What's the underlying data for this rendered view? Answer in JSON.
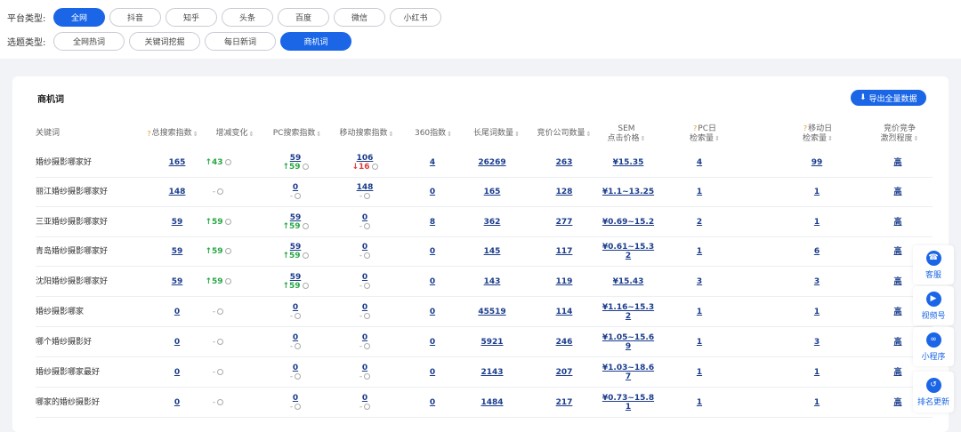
{
  "filters": {
    "platform_label": "平台类型:",
    "platforms": [
      "全网",
      "抖音",
      "知乎",
      "头条",
      "百度",
      "微信",
      "小红书"
    ],
    "platform_active": 0,
    "topic_label": "选题类型:",
    "topics": [
      "全网热词",
      "关键词挖掘",
      "每日新词",
      "商机词"
    ],
    "topic_active": 3
  },
  "card": {
    "title": "商机词",
    "export_label": "导出全量数据"
  },
  "headers": {
    "keyword": "关键词",
    "total": "总搜索指数",
    "change": "增减变化",
    "pc": "PC搜索指数",
    "mobile": "移动搜索指数",
    "s360": "360指数",
    "longtail": "长尾词数量",
    "bidco": "竞价公司数量",
    "sem_line1": "SEM",
    "sem_line2": "点击价格",
    "pcday_line1": "PC日",
    "pcday_line2": "检索量",
    "mday_line1": "移动日",
    "mday_line2": "检索量",
    "comp_line1": "竞价竞争",
    "comp_line2": "激烈程度"
  },
  "rows": [
    {
      "keyword": "婚纱摄影哪家好",
      "total": "165",
      "change": "43",
      "change_dir": "up",
      "pc": "59",
      "pc_sub": "59",
      "pc_sub_dir": "up",
      "mobile": "106",
      "mobile_sub": "16",
      "mobile_sub_dir": "down",
      "s360": "4",
      "longtail": "26269",
      "bidco": "263",
      "sem1": "¥15.35",
      "sem2": "",
      "pcday": "4",
      "mday": "99",
      "comp": "高"
    },
    {
      "keyword": "丽江婚纱摄影哪家好",
      "total": "148",
      "change": "-",
      "change_dir": "none",
      "pc": "0",
      "pc_sub": "-",
      "pc_sub_dir": "none",
      "mobile": "148",
      "mobile_sub": "-",
      "mobile_sub_dir": "none",
      "s360": "0",
      "longtail": "165",
      "bidco": "128",
      "sem1": "¥1.1~13.25",
      "sem2": "",
      "pcday": "1",
      "mday": "1",
      "comp": "高"
    },
    {
      "keyword": "三亚婚纱摄影哪家好",
      "total": "59",
      "change": "59",
      "change_dir": "up",
      "pc": "59",
      "pc_sub": "59",
      "pc_sub_dir": "up",
      "mobile": "0",
      "mobile_sub": "-",
      "mobile_sub_dir": "none",
      "s360": "8",
      "longtail": "362",
      "bidco": "277",
      "sem1": "¥0.69~15.2",
      "sem2": "",
      "pcday": "2",
      "mday": "1",
      "comp": "高"
    },
    {
      "keyword": "青岛婚纱摄影哪家好",
      "total": "59",
      "change": "59",
      "change_dir": "up",
      "pc": "59",
      "pc_sub": "59",
      "pc_sub_dir": "up",
      "mobile": "0",
      "mobile_sub": "-",
      "mobile_sub_dir": "none",
      "s360": "0",
      "longtail": "145",
      "bidco": "117",
      "sem1": "¥0.61~15.3",
      "sem2": "2",
      "pcday": "1",
      "mday": "6",
      "comp": "高"
    },
    {
      "keyword": "沈阳婚纱摄影哪家好",
      "total": "59",
      "change": "59",
      "change_dir": "up",
      "pc": "59",
      "pc_sub": "59",
      "pc_sub_dir": "up",
      "mobile": "0",
      "mobile_sub": "-",
      "mobile_sub_dir": "none",
      "s360": "0",
      "longtail": "143",
      "bidco": "119",
      "sem1": "¥15.43",
      "sem2": "",
      "pcday": "3",
      "mday": "3",
      "comp": "高"
    },
    {
      "keyword": "婚纱摄影哪家",
      "total": "0",
      "change": "-",
      "change_dir": "none",
      "pc": "0",
      "pc_sub": "-",
      "pc_sub_dir": "none",
      "mobile": "0",
      "mobile_sub": "-",
      "mobile_sub_dir": "none",
      "s360": "0",
      "longtail": "45519",
      "bidco": "114",
      "sem1": "¥1.16~15.3",
      "sem2": "2",
      "pcday": "1",
      "mday": "1",
      "comp": "高"
    },
    {
      "keyword": "哪个婚纱摄影好",
      "total": "0",
      "change": "-",
      "change_dir": "none",
      "pc": "0",
      "pc_sub": "-",
      "pc_sub_dir": "none",
      "mobile": "0",
      "mobile_sub": "-",
      "mobile_sub_dir": "none",
      "s360": "0",
      "longtail": "5921",
      "bidco": "246",
      "sem1": "¥1.05~15.6",
      "sem2": "9",
      "pcday": "1",
      "mday": "3",
      "comp": "高"
    },
    {
      "keyword": "婚纱摄影哪家最好",
      "total": "0",
      "change": "-",
      "change_dir": "none",
      "pc": "0",
      "pc_sub": "-",
      "pc_sub_dir": "none",
      "mobile": "0",
      "mobile_sub": "-",
      "mobile_sub_dir": "none",
      "s360": "0",
      "longtail": "2143",
      "bidco": "207",
      "sem1": "¥1.03~18.6",
      "sem2": "7",
      "pcday": "1",
      "mday": "1",
      "comp": "高"
    },
    {
      "keyword": "哪家的婚纱摄影好",
      "total": "0",
      "change": "-",
      "change_dir": "none",
      "pc": "0",
      "pc_sub": "-",
      "pc_sub_dir": "none",
      "mobile": "0",
      "mobile_sub": "-",
      "mobile_sub_dir": "none",
      "s360": "0",
      "longtail": "1484",
      "bidco": "217",
      "sem1": "¥0.73~15.8",
      "sem2": "1",
      "pcday": "1",
      "mday": "1",
      "comp": "高"
    }
  ],
  "side_tools": [
    {
      "label": "客服",
      "icon": "headset-icon",
      "glyph": "☎"
    },
    {
      "label": "视频号",
      "icon": "video-icon",
      "glyph": "▶"
    },
    {
      "label": "小程序",
      "icon": "miniprogram-icon",
      "glyph": "∞"
    },
    {
      "label": "排名更新",
      "icon": "history-icon",
      "glyph": "↺"
    }
  ],
  "colors": {
    "accent": "#1a66e6",
    "up": "#28a745",
    "down": "#e53935",
    "link": "#1a3c8c"
  }
}
